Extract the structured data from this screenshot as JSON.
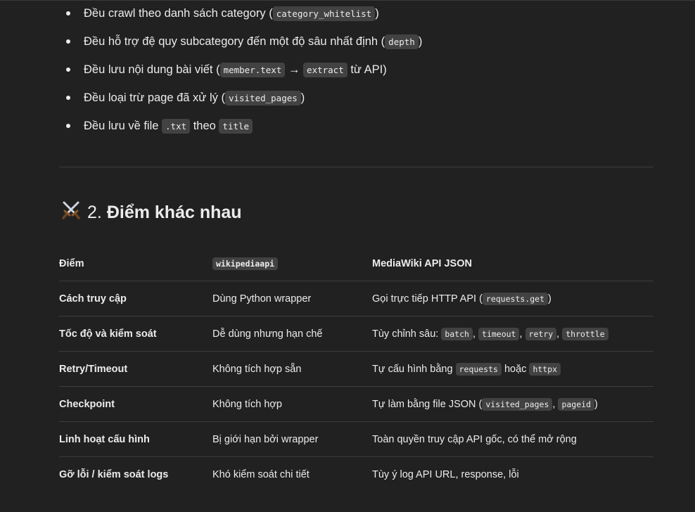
{
  "bullets": [
    {
      "pre": "Đều crawl theo danh sách category (",
      "code1": "category_whitelist",
      "post": ")"
    },
    {
      "pre": "Đều hỗ trợ đệ quy subcategory đến một độ sâu nhất định (",
      "code1": "depth",
      "post": ")"
    },
    {
      "pre": "Đều lưu nội dung bài viết (",
      "code1": "member.text",
      "mid": " → ",
      "code2": "extract",
      "post": " từ API)"
    },
    {
      "pre": "Đều loại trừ page đã xử lý (",
      "code1": "visited_pages",
      "post": ")"
    },
    {
      "pre": "Đều lưu về file ",
      "code1": ".txt",
      "mid": " theo ",
      "code2": "title",
      "post": ""
    }
  ],
  "heading": {
    "number": "2.",
    "title": "Điểm khác nhau",
    "icon": "crossed-swords-icon"
  },
  "table": {
    "header": {
      "col1": "Điểm",
      "col2_code": "wikipediaapi",
      "col3": "MediaWiki API JSON"
    },
    "rows": [
      {
        "c1": "Cách truy cập",
        "c2": "Dùng Python wrapper",
        "c3": {
          "pre": "Gọi trực tiếp HTTP API (",
          "codes": [
            "requests.get"
          ],
          "seps": [],
          "post": ")"
        }
      },
      {
        "c1": "Tốc độ và kiểm soát",
        "c2": "Dễ dùng nhưng hạn chế",
        "c3": {
          "pre": "Tùy chỉnh sâu: ",
          "codes": [
            "batch",
            "timeout",
            "retry",
            "throttle"
          ],
          "seps": [
            ", ",
            ", ",
            ", "
          ],
          "post": ""
        }
      },
      {
        "c1": "Retry/Timeout",
        "c2": "Không tích hợp sẵn",
        "c3": {
          "pre": "Tự cấu hình bằng ",
          "codes": [
            "requests",
            "httpx"
          ],
          "seps": [
            " hoặc "
          ],
          "post": ""
        }
      },
      {
        "c1": "Checkpoint",
        "c2": "Không tích hợp",
        "c3": {
          "pre": "Tự làm bằng file JSON (",
          "codes": [
            "visited_pages",
            "pageid"
          ],
          "seps": [
            ", "
          ],
          "post": ")"
        }
      },
      {
        "c1": "Linh hoạt cấu hình",
        "c2": "Bị giới hạn bởi wrapper",
        "c3": {
          "pre": "Toàn quyền truy cập API gốc, có thể mở rộng",
          "codes": [],
          "seps": [],
          "post": ""
        }
      },
      {
        "c1": "Gỡ lỗi / kiểm soát logs",
        "c2": "Khó kiểm soát chi tiết",
        "c3": {
          "pre": "Tùy ý log API URL, response, lỗi",
          "codes": [],
          "seps": [],
          "post": ""
        }
      }
    ]
  }
}
